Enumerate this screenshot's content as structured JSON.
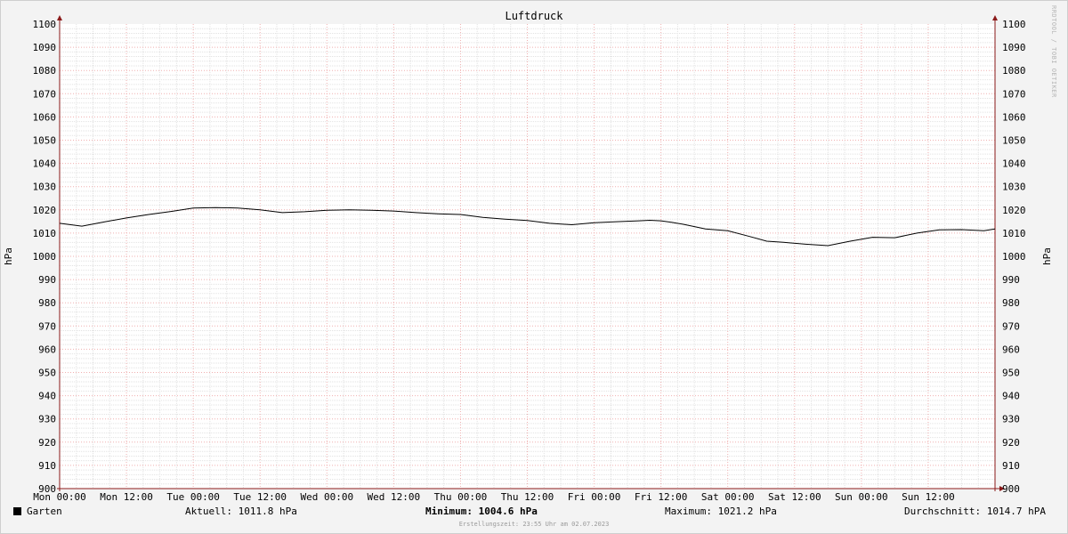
{
  "chart_data": {
    "type": "line",
    "title": "Luftdruck",
    "ylabel": "hPa",
    "ylabel_right": "hPa",
    "ylim": [
      900,
      1100
    ],
    "ytick_step": 10,
    "yticks": [
      "1100",
      "1090",
      "1080",
      "1070",
      "1060",
      "1050",
      "1040",
      "1030",
      "1020",
      "1010",
      "1000",
      "990",
      "980",
      "970",
      "960",
      "950",
      "940",
      "930",
      "920",
      "910",
      "900"
    ],
    "xlim_hours": [
      0,
      168
    ],
    "xticks": [
      "Mon 00:00",
      "Mon 12:00",
      "Tue 00:00",
      "Tue 12:00",
      "Wed 00:00",
      "Wed 12:00",
      "Thu 00:00",
      "Thu 12:00",
      "Fri 00:00",
      "Fri 12:00",
      "Sat 00:00",
      "Sat 12:00",
      "Sun 00:00",
      "Sun 12:00"
    ],
    "grid": true,
    "legend_position": "bottom-left",
    "series": [
      {
        "name": "Garten",
        "color": "#000000",
        "x_hours": [
          0,
          4,
          8,
          12,
          16,
          20,
          24,
          28,
          32,
          36,
          40,
          44,
          48,
          52,
          56,
          60,
          64,
          68,
          72,
          76,
          80,
          84,
          88,
          92,
          96,
          100,
          104,
          106,
          108,
          110,
          112,
          116,
          120,
          124,
          127,
          130,
          134,
          138,
          142,
          146,
          150,
          154,
          158,
          162,
          166,
          168
        ],
        "values": [
          1014.2,
          1013.0,
          1014.8,
          1016.5,
          1018.0,
          1019.3,
          1020.8,
          1021.0,
          1020.8,
          1020.0,
          1018.8,
          1019.2,
          1019.8,
          1020.0,
          1019.8,
          1019.5,
          1018.8,
          1018.3,
          1018.0,
          1016.8,
          1016.0,
          1015.4,
          1014.2,
          1013.6,
          1014.5,
          1014.9,
          1015.3,
          1015.5,
          1015.3,
          1014.6,
          1013.8,
          1011.8,
          1011.0,
          1008.5,
          1006.5,
          1006.0,
          1005.2,
          1004.6,
          1006.5,
          1008.2,
          1008.0,
          1010.0,
          1011.4,
          1011.5,
          1011.0,
          1011.8
        ]
      }
    ]
  },
  "legend": {
    "label": "Garten",
    "swatch_color": "#000000"
  },
  "stats": {
    "current": "Aktuell: 1011.8 hPa",
    "minimum": "Minimum: 1004.6 hPa",
    "maximum": "Maximum: 1021.2 hPa",
    "average": "Durchschnitt: 1014.7 hPA"
  },
  "watermark": "RRDTOOL / TOBI OETIKER",
  "footer": "Erstellungszeit: 23:55 Uhr am 02.07.2023"
}
